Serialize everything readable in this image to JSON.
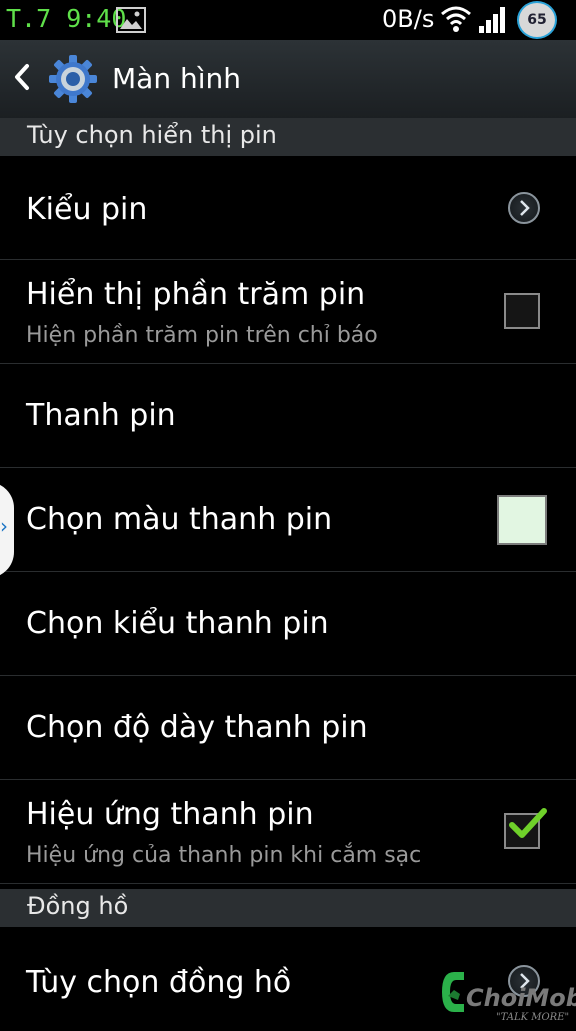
{
  "status_bar": {
    "time": "T.7 9:40",
    "net_speed": "0B/s",
    "battery_level": "65",
    "icons": [
      "gallery-icon",
      "wifi-icon",
      "signal-icon",
      "battery-icon"
    ],
    "time_color": "#5fe04a"
  },
  "action_bar": {
    "title": "Màn hình",
    "icons": [
      "back-arrow-icon",
      "settings-gear-icon"
    ]
  },
  "sections": [
    {
      "header": "Tùy chọn hiển thị pin",
      "items": [
        {
          "title": "Kiểu pin",
          "control": "chevron"
        },
        {
          "title": "Hiển thị phần trăm pin",
          "subtitle": "Hiện phần trăm pin trên chỉ báo",
          "control": "checkbox",
          "checked": false
        },
        {
          "title": "Thanh pin",
          "control": "none"
        },
        {
          "title": "Chọn màu thanh pin",
          "control": "color-swatch",
          "color": "#e2f6e2"
        },
        {
          "title": "Chọn kiểu thanh pin",
          "control": "none"
        },
        {
          "title": "Chọn độ dày thanh pin",
          "control": "none"
        },
        {
          "title": "Hiệu ứng thanh pin",
          "subtitle": "Hiệu ứng của thanh pin khi cắm sạc",
          "control": "checkbox",
          "checked": true
        }
      ]
    },
    {
      "header": "Đồng hồ",
      "items": [
        {
          "title": "Tùy chọn đồng hồ",
          "control": "chevron"
        }
      ]
    }
  ],
  "side_tab": {
    "glyph": "›"
  },
  "watermark": {
    "brand": "ChoiMobile",
    "slogan": "\"TALK MORE\"",
    "letter": "C"
  },
  "colors": {
    "background": "#000000",
    "section_header": "#2b2f32",
    "checkmark": "#6fd12a",
    "side_tab_arrow": "#1a73c4"
  }
}
